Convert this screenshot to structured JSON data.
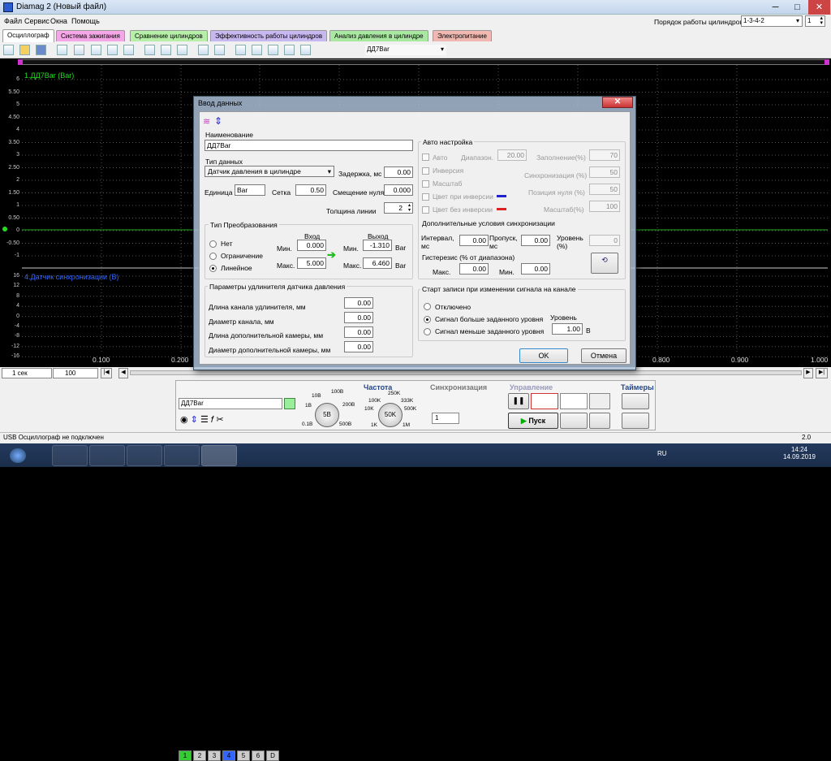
{
  "app": {
    "title": "Diamag 2 (Новый файл)"
  },
  "window": {
    "min": "─",
    "max": "□",
    "close": "✕"
  },
  "menu": [
    "Файл",
    "Сервис",
    "Окна",
    "Помощь"
  ],
  "cyl": {
    "label": "Порядок работы цилиндров",
    "order": "1-3-4-2",
    "num": "1"
  },
  "tabs": [
    {
      "label": "Осциллограф",
      "color": "#ffffff"
    },
    {
      "label": "Система зажигания",
      "color": "#f5a6e6"
    },
    {
      "label": "Сравнение цилиндров",
      "color": "#b6f0a8"
    },
    {
      "label": "Эффективность работы цилиндров",
      "color": "#c8b8f0"
    },
    {
      "label": "Анализ давления в цилиндре",
      "color": "#a8e8a0"
    },
    {
      "label": "Электропитание",
      "color": "#f0b8b0"
    }
  ],
  "toolbar": {
    "channel": "ДД7Bar"
  },
  "plot": {
    "ch1_label": "1.ДД7Bar (Bar)",
    "ch4_label": "4.Датчик синхронизации (В)",
    "y1": [
      "6",
      "5.50",
      "5",
      "4.50",
      "4",
      "3.50",
      "3",
      "2.50",
      "2",
      "1.50",
      "1",
      "0.50",
      "0",
      "-0.50",
      "-1"
    ],
    "y2": [
      "16",
      "12",
      "8",
      "4",
      "0",
      "-4",
      "-8",
      "-12",
      "-16"
    ],
    "x": [
      "0.100",
      "0.200",
      "0.800",
      "0.900",
      "1.000"
    ]
  },
  "controls": {
    "time": "1 сек",
    "zoom": "100",
    "channels": [
      "1",
      "2",
      "3",
      "4",
      "5",
      "6",
      "D"
    ],
    "channel_name": "ДД7Bar",
    "voltage": [
      "10В",
      "100В",
      "1В",
      "200В",
      "0.1В",
      "500В"
    ],
    "v_knob": "5В",
    "freq_title": "Частота",
    "freq": [
      "250K",
      "100K",
      "333K",
      "10K",
      "500K",
      "1K",
      "1M"
    ],
    "f_knob": "50K",
    "sync_title": "Синхронизация",
    "sync_val": "1",
    "mgmt_title": "Управление",
    "start": "Пуск",
    "timers_title": "Таймеры"
  },
  "status": {
    "left": "USB Осциллограф не подключен",
    "right": "2.0"
  },
  "taskbar": {
    "lang": "RU",
    "time": "14:24",
    "date": "14.09.2019"
  },
  "dialog": {
    "title": "Ввод данных",
    "name_label": "Наименование",
    "name_value": "ДД7Bar",
    "type_label": "Тип данных",
    "type_value": "Датчик давления в цилиндре",
    "delay_label": "Задержка, мс",
    "delay_value": "0.00",
    "unit_label": "Единица",
    "unit_value": "Bar",
    "grid_label": "Сетка",
    "grid_value": "0.50",
    "zero_label": "Смещение нуля",
    "zero_value": "0.000",
    "thick_label": "Толщина линии",
    "thick_value": "2",
    "conv_title": "Тип Преобразования",
    "conv_opts": [
      "Нет",
      "Ограничение",
      "Линейное"
    ],
    "in_label": "Вход",
    "out_label": "Выход",
    "min_label": "Мин.",
    "max_label": "Макс.",
    "in_min": "0.000",
    "in_max": "5.000",
    "out_min": "-1.310",
    "out_max": "6.460",
    "out_unit": "Bar",
    "auto_title": "Авто настройка",
    "auto": "Авто",
    "range_label": "Диапазон.",
    "range_value": "20.00",
    "fill_label": "Заполнение(%)",
    "fill_value": "70",
    "inv": "Инверсия",
    "sync_label": "Синхронизация (%)",
    "sync_value": "50",
    "scale": "Масштаб",
    "zeropos_label": "Позиция нуля (%)",
    "zeropos_value": "50",
    "color_inv": "Цвет при инверсии",
    "color_noinv": "Цвет без инверсии",
    "scale2_label": "Масштаб(%)",
    "scale2_value": "100",
    "extra_title": "Дополнительные условия синхронизации",
    "interval_label": "Интервал, мс",
    "interval_value": "0.00",
    "skip_label": "Пропуск, мс",
    "skip_value": "0.00",
    "level_label": "Уровень (%)",
    "level_value": "0",
    "hyst_label": "Гистерезис (% от диапазона)",
    "hyst_max_label": "Макс.",
    "hyst_max": "0.00",
    "hyst_min_label": "Мин.",
    "hyst_min": "0.00",
    "ext_title": "Параметры удлинителя датчика давления",
    "ext_rows": [
      {
        "label": "Длина канала удлинителя, мм",
        "value": "0.00"
      },
      {
        "label": "Диаметр канала, мм",
        "value": "0.00"
      },
      {
        "label": "Длина дополнительной камеры, мм",
        "value": "0.00"
      },
      {
        "label": "Диаметр дополнительной камеры, мм",
        "value": "0.00"
      }
    ],
    "rec_title": "Старт записи при изменении сигнала на канале",
    "rec_opts": [
      "Отключено",
      "Сигнал больше заданного уровня",
      "Сигнал меньше заданного уровня"
    ],
    "rec_level_label": "Уровень",
    "rec_level": "1.00",
    "rec_unit": "В",
    "ok": "OK",
    "cancel": "Отмена"
  }
}
